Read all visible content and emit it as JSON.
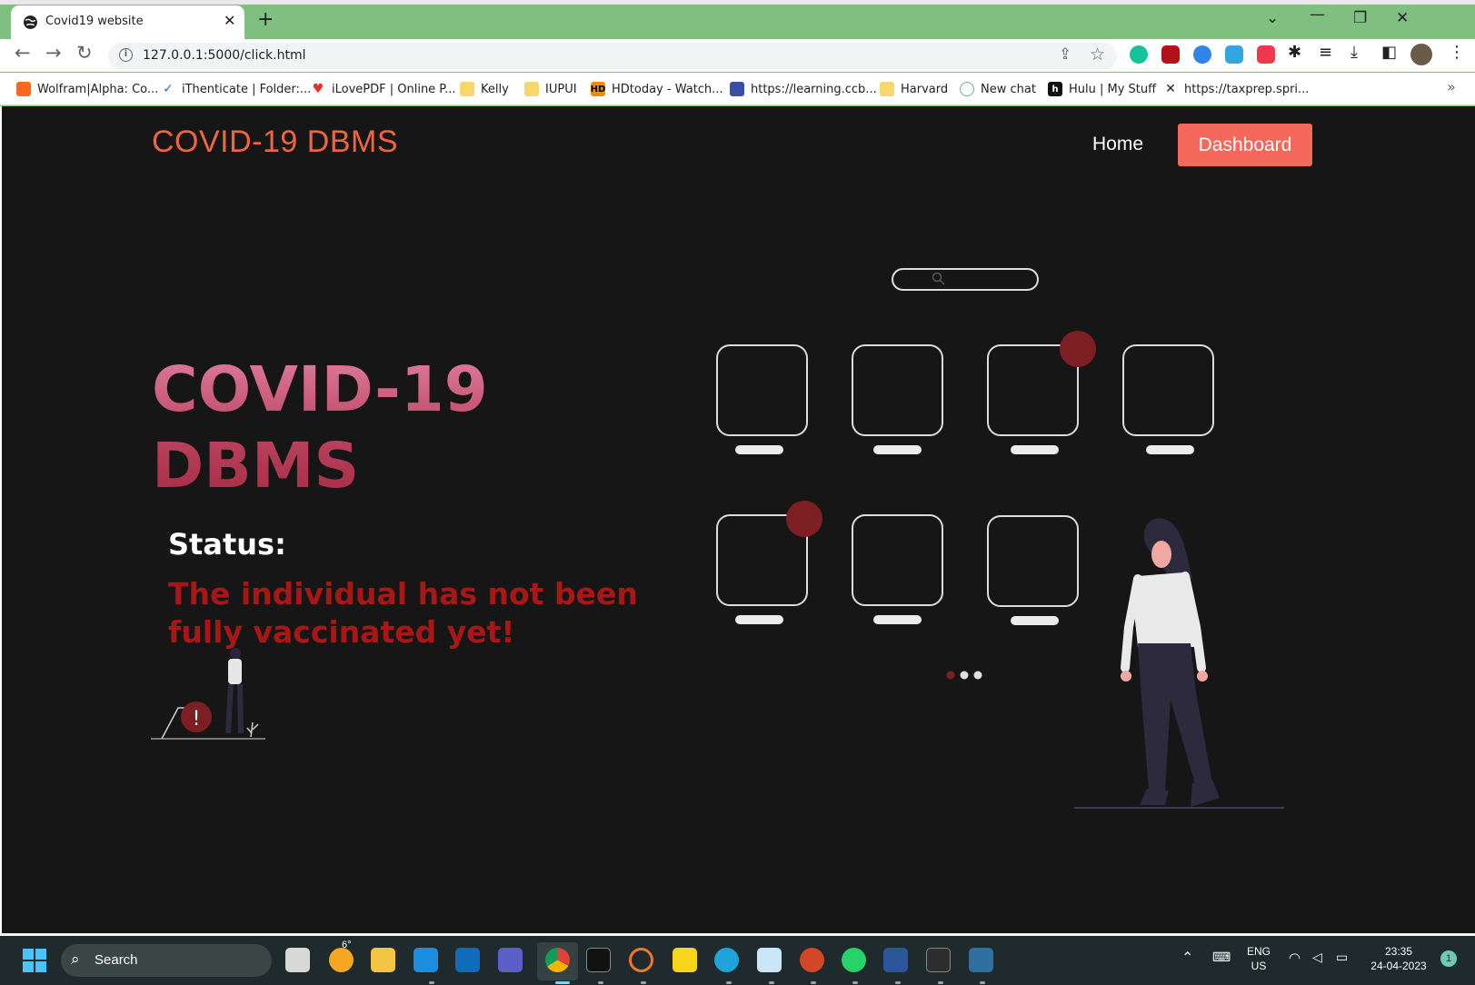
{
  "browser": {
    "tab_title": "Covid19 website",
    "tab_close": "✕",
    "new_tab": "+",
    "url": "127.0.0.1:5000/click.html",
    "bookmarks": [
      {
        "label": "Wolfram|Alpha: Co...",
        "icon": "wolfram-icon",
        "color": "#f96a1f"
      },
      {
        "label": "iThenticate | Folder:...",
        "icon": "checkmark-icon",
        "color": "#1a73e8"
      },
      {
        "label": "iLovePDF | Online P...",
        "icon": "heart-icon",
        "color": "#e5322d"
      },
      {
        "label": "Kelly",
        "icon": "folder-icon",
        "color": "#f5d76e"
      },
      {
        "label": "IUPUI",
        "icon": "folder-icon",
        "color": "#f5d76e"
      },
      {
        "label": "HDtoday - Watch...",
        "icon": "hd-icon",
        "color": "#f08a00"
      },
      {
        "label": "https://learning.ccb...",
        "icon": "ccb-icon",
        "color": "#3c4ea3"
      },
      {
        "label": "Harvard",
        "icon": "folder-icon",
        "color": "#f5d76e"
      },
      {
        "label": "New chat",
        "icon": "openai-icon",
        "color": "#7aa89a"
      },
      {
        "label": "Hulu | My Stuff",
        "icon": "hulu-icon",
        "color": "#111111"
      },
      {
        "label": "https://taxprep.spri...",
        "icon": "taxprep-icon",
        "color": "#222222"
      }
    ],
    "bookmarks_overflow": "»"
  },
  "navbar": {
    "brand": "COVID-19 DBMS",
    "home": "Home",
    "dashboard": "Dashboard"
  },
  "hero": {
    "title_line1": "COVID-19",
    "title_line2": "DBMS",
    "status_label": "Status:",
    "status_message": "The individual has not been fully vaccinated yet!"
  },
  "colors": {
    "brand": "#f0653f",
    "dashboard_button": "#f4695b",
    "status_message": "#a81716",
    "illustration_accent": "#7d1f22"
  },
  "taskbar": {
    "search_label": "Search",
    "weather": "6°",
    "lang_line1": "ENG",
    "lang_line2": "US",
    "time": "23:35",
    "date": "24-04-2023",
    "notification_count": "1"
  }
}
